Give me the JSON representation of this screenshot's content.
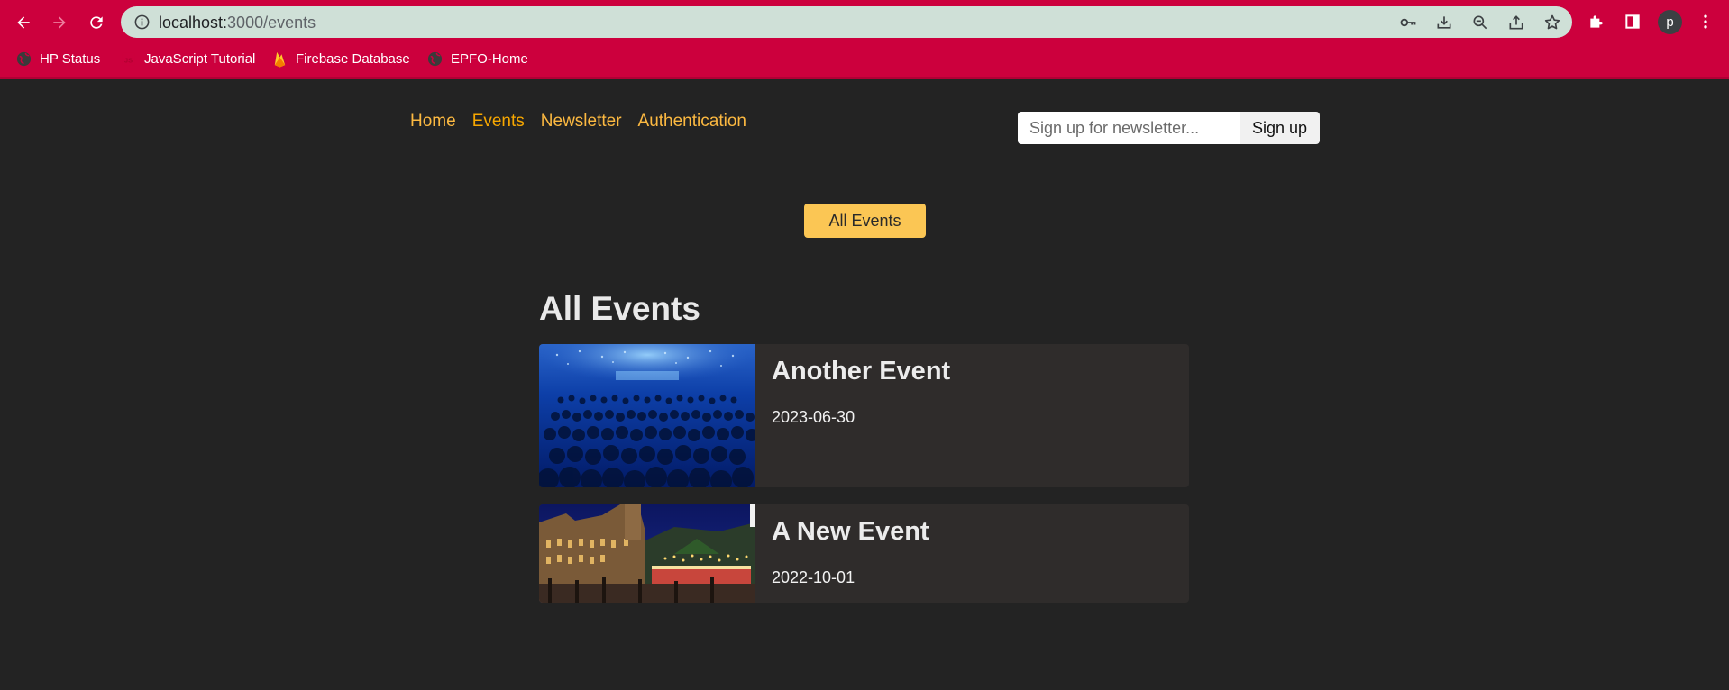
{
  "browser": {
    "url_host": "localhost:",
    "url_rest": "3000/events",
    "profile_initial": "p",
    "bookmarks": [
      {
        "label": "HP Status",
        "icon": "globe-icon"
      },
      {
        "label": "JavaScript Tutorial",
        "icon": "js-icon"
      },
      {
        "label": "Firebase Database",
        "icon": "firebase-icon"
      },
      {
        "label": "EPFO-Home",
        "icon": "globe-icon"
      }
    ]
  },
  "nav": {
    "home": "Home",
    "events": "Events",
    "newsletter": "Newsletter",
    "authentication": "Authentication"
  },
  "newsletter": {
    "placeholder": "Sign up for newsletter...",
    "button": "Sign up"
  },
  "events_nav": {
    "all_events": "All Events"
  },
  "events": {
    "heading": "All Events",
    "items": [
      {
        "title": "Another Event",
        "date": "2023-06-30",
        "image": "concert-crowd"
      },
      {
        "title": "A New Event",
        "date": "2022-10-01",
        "image": "christmas-market"
      }
    ]
  },
  "colors": {
    "chrome": "#cc003d",
    "page_bg": "#232323",
    "accent": "#fcb941",
    "button_bg": "#fbc654",
    "card_bg": "#2f2c2b"
  }
}
